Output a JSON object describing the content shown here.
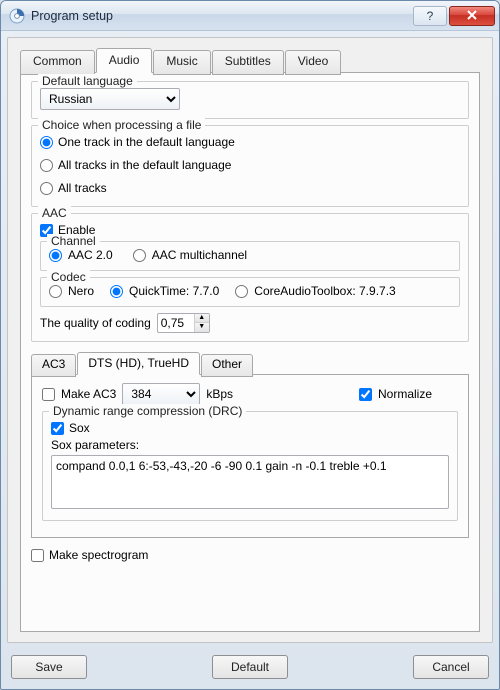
{
  "window": {
    "title": "Program setup"
  },
  "tabs": {
    "common": "Common",
    "audio": "Audio",
    "music": "Music",
    "subtitles": "Subtitles",
    "video": "Video"
  },
  "default_language": {
    "legend": "Default language",
    "value": "Russian"
  },
  "processing_choice": {
    "legend": "Choice when processing a file",
    "opt_one": "One track in the default language",
    "opt_all_default": "All tracks in the default language",
    "opt_all": "All tracks"
  },
  "aac": {
    "legend": "AAC",
    "enable": "Enable",
    "channel_legend": "Channel",
    "channel_aac20": "AAC 2.0",
    "channel_multi": "AAC multichannel",
    "codec_legend": "Codec",
    "codec_nero": "Nero",
    "codec_qt": "QuickTime: 7.7.0",
    "codec_cat": "CoreAudioToolbox: 7.9.7.3",
    "quality_label": "The quality of coding",
    "quality_value": "0,75"
  },
  "subtabs": {
    "ac3": "AC3",
    "dts": "DTS (HD), TrueHD",
    "other": "Other"
  },
  "dts": {
    "make_ac3": "Make AC3",
    "bitrate_value": "384",
    "bitrate_unit": "kBps",
    "normalize": "Normalize",
    "drc_legend": "Dynamic range compression (DRC)",
    "sox": "Sox",
    "sox_params_label": "Sox parameters:",
    "sox_params_value": "compand 0.0,1 6:-53,-43,-20 -6 -90 0.1 gain -n -0.1 treble +0.1"
  },
  "spectrogram": "Make spectrogram",
  "buttons": {
    "save": "Save",
    "default": "Default",
    "cancel": "Cancel"
  }
}
